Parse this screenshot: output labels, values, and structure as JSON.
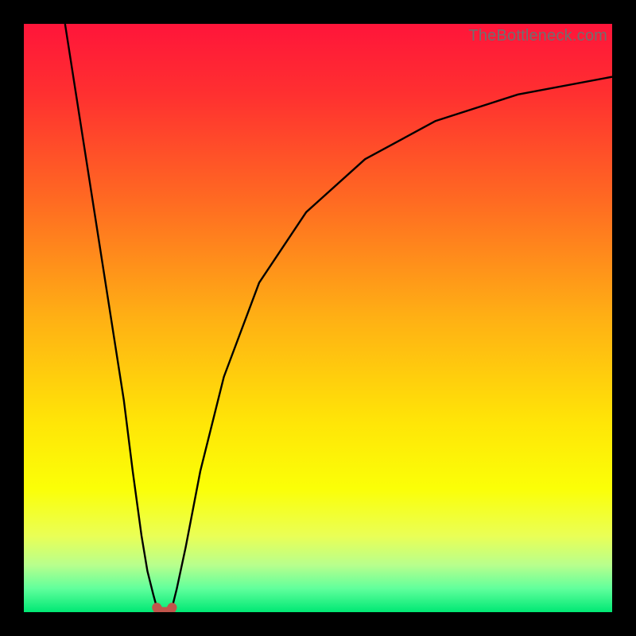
{
  "watermark": "TheBottleneck.com",
  "chart_data": {
    "type": "line",
    "title": "",
    "xlabel": "",
    "ylabel": "",
    "xlim": [
      0,
      100
    ],
    "ylim": [
      0,
      100
    ],
    "grid": false,
    "legend": false,
    "axes_visible": false,
    "gradient_stops": [
      {
        "offset": 0.0,
        "color": "#ff153a"
      },
      {
        "offset": 0.12,
        "color": "#ff3030"
      },
      {
        "offset": 0.3,
        "color": "#ff6a22"
      },
      {
        "offset": 0.5,
        "color": "#ffb014"
      },
      {
        "offset": 0.68,
        "color": "#ffe607"
      },
      {
        "offset": 0.79,
        "color": "#fbff07"
      },
      {
        "offset": 0.87,
        "color": "#eaff55"
      },
      {
        "offset": 0.92,
        "color": "#b8ff8d"
      },
      {
        "offset": 0.96,
        "color": "#60ff9c"
      },
      {
        "offset": 1.0,
        "color": "#00e874"
      }
    ],
    "series": [
      {
        "name": "left-branch",
        "color": "#000000",
        "width": 2.4,
        "x": [
          7,
          9.5,
          12,
          14.5,
          17,
          18.5,
          20,
          21,
          22,
          22.6
        ],
        "y": [
          100,
          84,
          68,
          52,
          36,
          24,
          13,
          7,
          3,
          0.8
        ]
      },
      {
        "name": "right-branch",
        "color": "#000000",
        "width": 2.4,
        "x": [
          25.2,
          26,
          27.5,
          30,
          34,
          40,
          48,
          58,
          70,
          84,
          100
        ],
        "y": [
          0.8,
          4,
          11,
          24,
          40,
          56,
          68,
          77,
          83.5,
          88,
          91
        ]
      },
      {
        "name": "optimum-segment",
        "color": "#c1554b",
        "width": 12,
        "linecap": "round",
        "x": [
          22.6,
          22.9,
          23.5,
          24.3,
          24.9,
          25.2
        ],
        "y": [
          0.8,
          0.25,
          0.05,
          0.05,
          0.25,
          0.8
        ]
      }
    ]
  }
}
